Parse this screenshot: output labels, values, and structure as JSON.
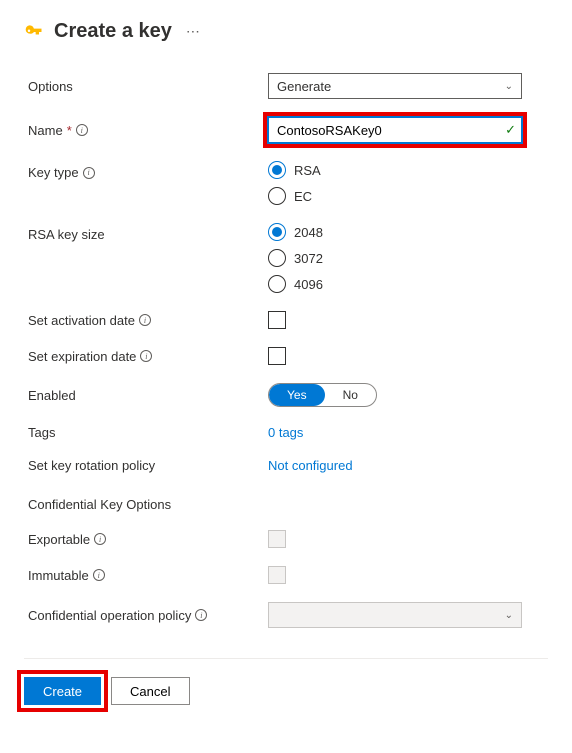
{
  "header": {
    "title": "Create a key"
  },
  "form": {
    "options": {
      "label": "Options",
      "value": "Generate"
    },
    "name": {
      "label": "Name",
      "value": "ContosoRSAKey0"
    },
    "keyType": {
      "label": "Key type",
      "options": [
        "RSA",
        "EC"
      ],
      "selected": "RSA"
    },
    "rsaKeySize": {
      "label": "RSA key size",
      "options": [
        "2048",
        "3072",
        "4096"
      ],
      "selected": "2048"
    },
    "activationDate": {
      "label": "Set activation date"
    },
    "expirationDate": {
      "label": "Set expiration date"
    },
    "enabled": {
      "label": "Enabled",
      "yes": "Yes",
      "no": "No"
    },
    "tags": {
      "label": "Tags",
      "value": "0 tags"
    },
    "rotationPolicy": {
      "label": "Set key rotation policy",
      "value": "Not configured"
    },
    "confidentialSection": "Confidential Key Options",
    "exportable": {
      "label": "Exportable"
    },
    "immutable": {
      "label": "Immutable"
    },
    "confidentialPolicy": {
      "label": "Confidential operation policy"
    }
  },
  "footer": {
    "create": "Create",
    "cancel": "Cancel"
  }
}
